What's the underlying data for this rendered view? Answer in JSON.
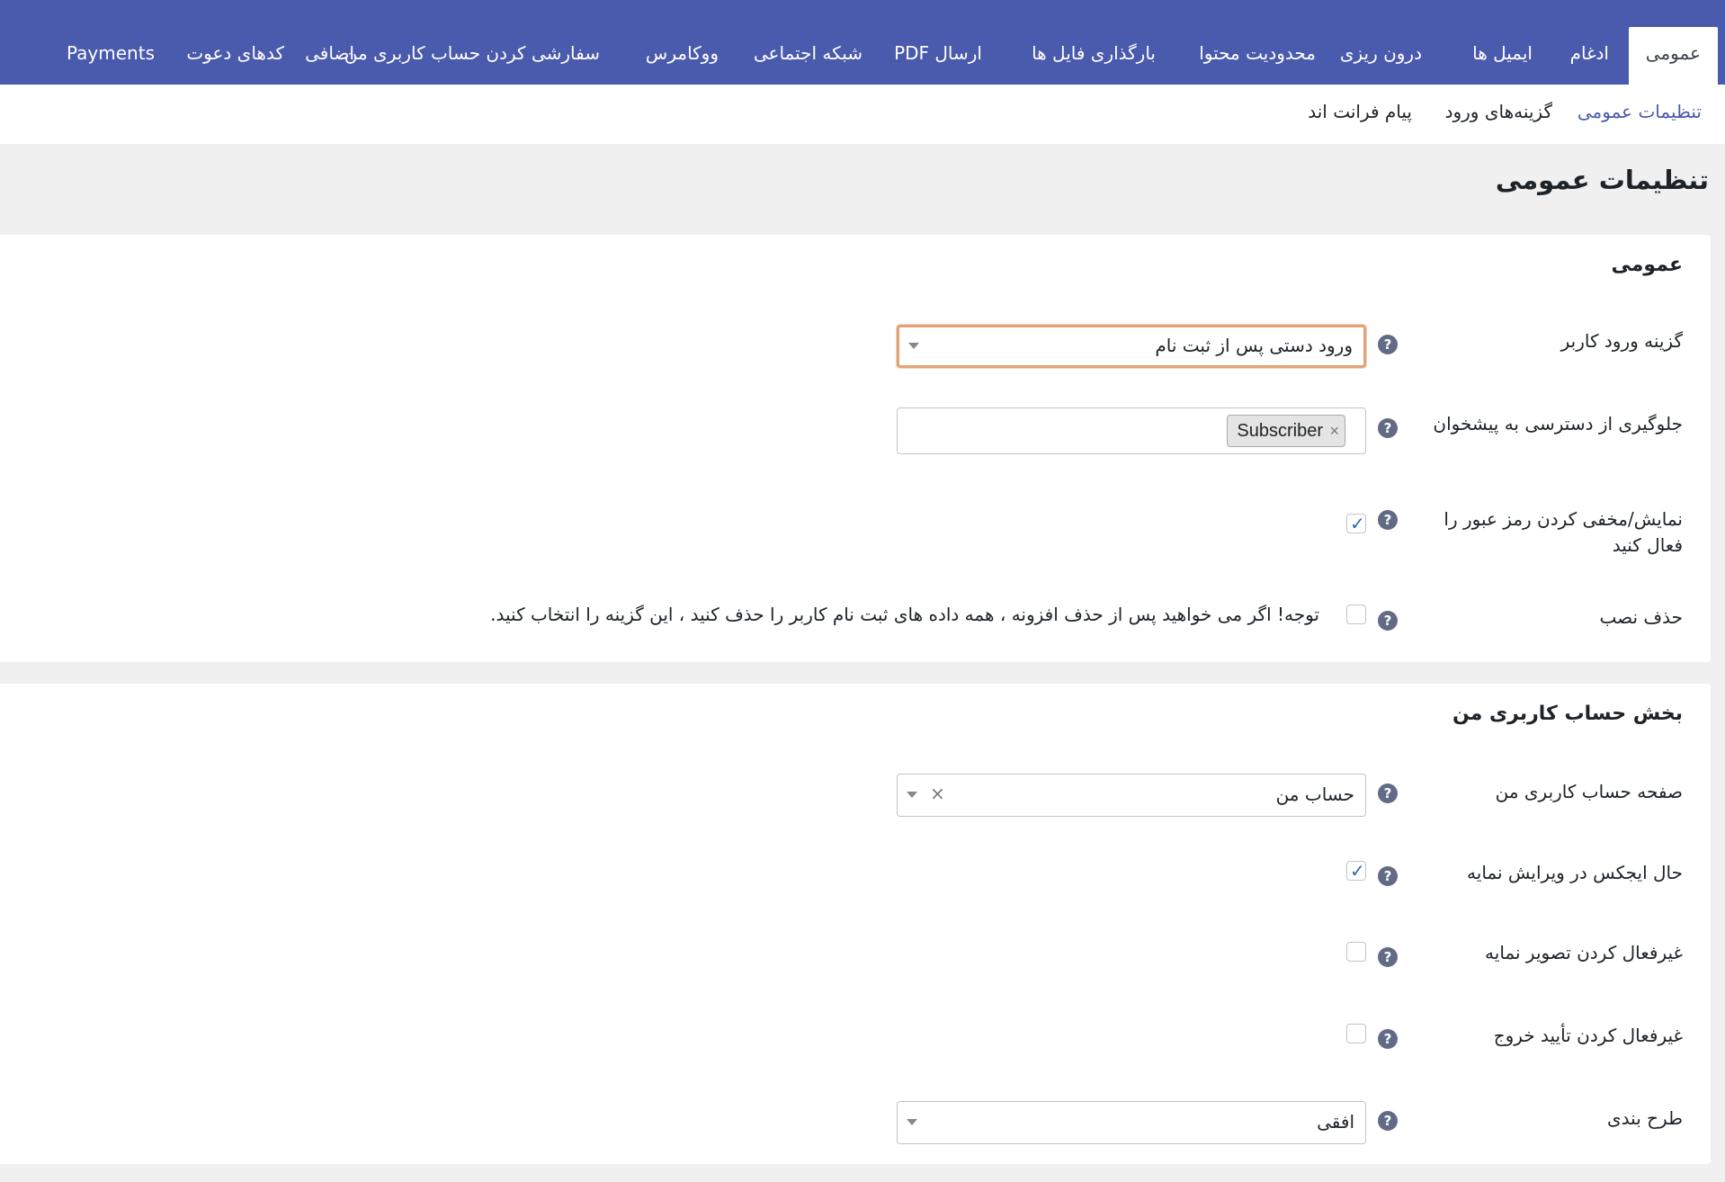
{
  "tabs": {
    "t1": "عمومی",
    "t2": "ادغام",
    "t3": "ایمیل ها",
    "t4": "درون ریزی",
    "t5": "محدودیت محتوا",
    "t6": "بارگذاری فایل ها",
    "t7": "ارسال PDF",
    "t8": "شبکه اجتماعی",
    "t9": "ووکامرس",
    "t10": "سفارشی کردن حساب کاربری من",
    "t11": "اضافی",
    "t12": "کدهای دعوت",
    "t13": "Payments"
  },
  "subtabs": {
    "s1": "تنظیمات عمومی",
    "s2": "گزینه‌های ورود",
    "s3": "پیام فرانت اند"
  },
  "page_title": "تنظیمات عمومی",
  "general": {
    "title": "عمومی",
    "login_option_label": "گزینه ورود کاربر",
    "login_option_value": "ورود دستی پس از ثبت نام",
    "prevent_dashboard_label": "جلوگیری از دسترسی به پیشخوان",
    "prevent_dashboard_tag": "Subscriber",
    "show_hide_password_label": "نمایش/مخفی کردن رمز عبور را فعال کنید",
    "show_hide_password_checked": true,
    "uninstall_label": "حذف نصب",
    "uninstall_note": "توجه! اگر می خواهید پس از حذف افزونه ، همه داده های ثبت نام کاربر را حذف کنید ، این گزینه را انتخاب کنید.",
    "uninstall_checked": false
  },
  "myaccount": {
    "title": "بخش حساب کاربری من",
    "page_label": "صفحه حساب کاربری من",
    "page_value": "حساب من",
    "ajax_label": "حال ایجکس در ویرایش نمایه",
    "ajax_checked": true,
    "disable_profile_image_label": "غیرفعال کردن تصویر نمایه",
    "disable_profile_image_checked": false,
    "disable_logout_confirm_label": "غیرفعال کردن تأیید خروج",
    "disable_logout_confirm_checked": false,
    "layout_label": "طرح بندی",
    "layout_value": "افقی"
  },
  "icons": {
    "help": "?",
    "check": "✓",
    "clear": "×"
  },
  "colors": {
    "nav_bg": "#4a5aac",
    "focus_border": "#e3a376",
    "help_icon": "#626a86"
  }
}
